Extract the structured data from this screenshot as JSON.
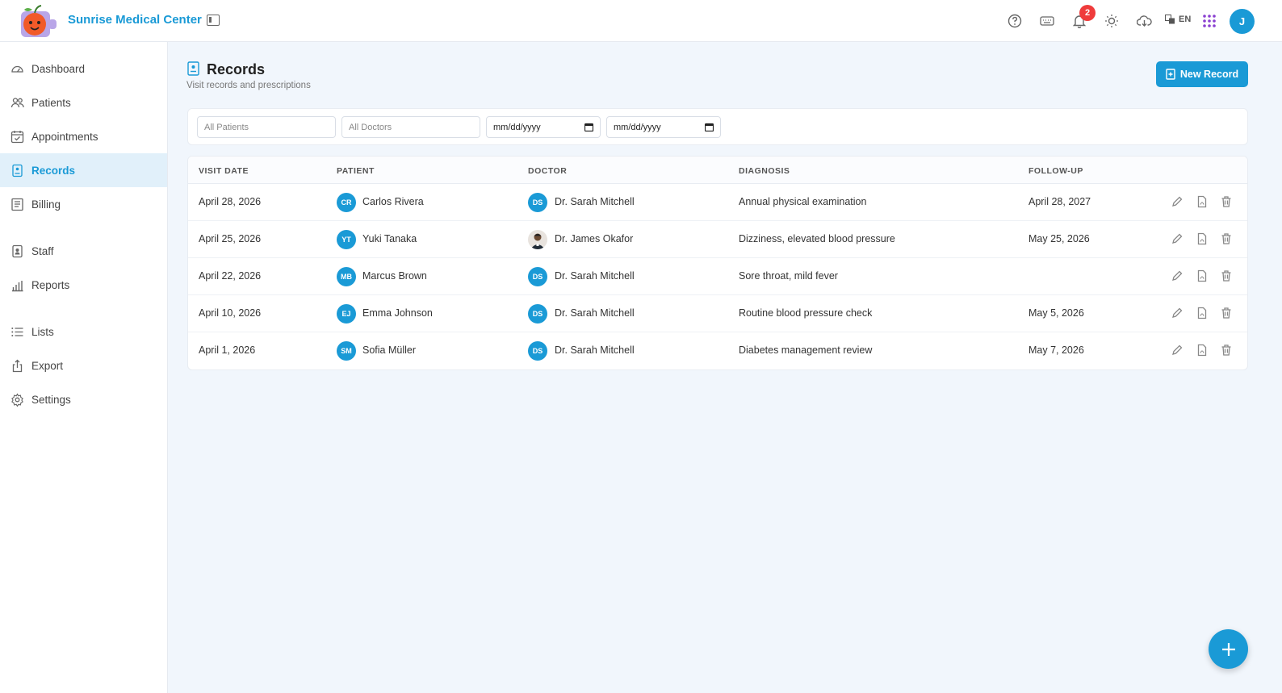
{
  "app": {
    "title": "Sunrise Medical Center"
  },
  "header": {
    "notification_count": "2",
    "language": "EN",
    "user_initial": "J"
  },
  "sidebar": {
    "items": [
      {
        "label": "Dashboard",
        "icon": "gauge-icon"
      },
      {
        "label": "Patients",
        "icon": "users-icon"
      },
      {
        "label": "Appointments",
        "icon": "calendar-check-icon"
      },
      {
        "label": "Records",
        "icon": "record-file-icon"
      },
      {
        "label": "Billing",
        "icon": "billing-icon"
      },
      {
        "label": "Staff",
        "icon": "staff-badge-icon"
      },
      {
        "label": "Reports",
        "icon": "bar-chart-icon"
      },
      {
        "label": "Lists",
        "icon": "list-icon"
      },
      {
        "label": "Export",
        "icon": "share-icon"
      },
      {
        "label": "Settings",
        "icon": "gear-icon"
      }
    ],
    "active": "Records"
  },
  "page": {
    "title": "Records",
    "subtitle": "Visit records and prescriptions",
    "new_button": "New Record"
  },
  "filters": {
    "patients_placeholder": "All Patients",
    "doctors_placeholder": "All Doctors",
    "date_from": "mm/dd/yyyy",
    "date_to": "mm/dd/yyyy"
  },
  "table": {
    "columns": [
      "VISIT DATE",
      "PATIENT",
      "DOCTOR",
      "DIAGNOSIS",
      "FOLLOW-UP"
    ],
    "rows": [
      {
        "visit_date": "April 28, 2026",
        "patient_initials": "CR",
        "patient": "Carlos Rivera",
        "doctor_initials": "DS",
        "doctor": "Dr. Sarah Mitchell",
        "diagnosis": "Annual physical examination",
        "follow_up": "April 28, 2027"
      },
      {
        "visit_date": "April 25, 2026",
        "patient_initials": "YT",
        "patient": "Yuki Tanaka",
        "doctor_initials": "",
        "doctor": "Dr. James Okafor",
        "diagnosis": "Dizziness, elevated blood pressure",
        "follow_up": "May 25, 2026"
      },
      {
        "visit_date": "April 22, 2026",
        "patient_initials": "MB",
        "patient": "Marcus Brown",
        "doctor_initials": "DS",
        "doctor": "Dr. Sarah Mitchell",
        "diagnosis": "Sore throat, mild fever",
        "follow_up": ""
      },
      {
        "visit_date": "April 10, 2026",
        "patient_initials": "EJ",
        "patient": "Emma Johnson",
        "doctor_initials": "DS",
        "doctor": "Dr. Sarah Mitchell",
        "diagnosis": "Routine blood pressure check",
        "follow_up": "May 5, 2026"
      },
      {
        "visit_date": "April 1, 2026",
        "patient_initials": "SM",
        "patient": "Sofia Müller",
        "doctor_initials": "DS",
        "doctor": "Dr. Sarah Mitchell",
        "diagnosis": "Diabetes management review",
        "follow_up": "May 7, 2026"
      }
    ]
  },
  "colors": {
    "accent": "#1a9ad6",
    "badge": "#ef3b3b",
    "background": "#f1f6fc"
  }
}
